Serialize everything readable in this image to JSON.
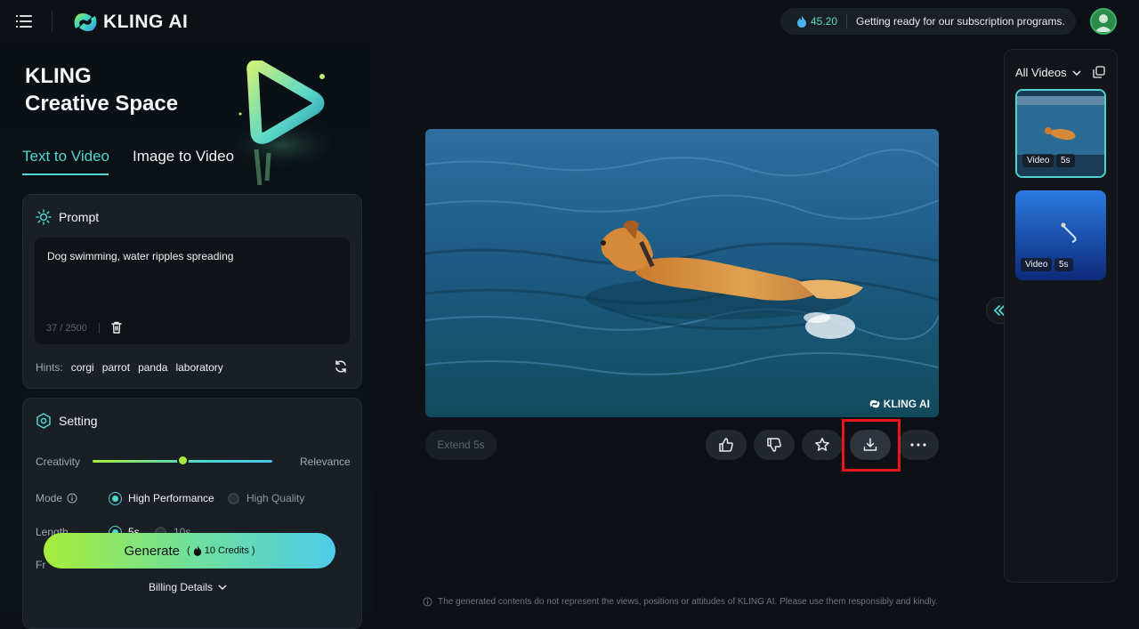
{
  "header": {
    "brand": "KLING AI",
    "credits_amount": "45.20",
    "announcement": "Getting ready for our subscription programs."
  },
  "hero": {
    "line1": "KLING",
    "line2": "Creative Space"
  },
  "tabs": [
    {
      "label": "Text to Video",
      "active": true
    },
    {
      "label": "Image to Video",
      "active": false
    }
  ],
  "prompt": {
    "title": "Prompt",
    "value": "Dog swimming, water ripples spreading",
    "counter": "37 / 2500",
    "hints_label": "Hints:",
    "hints": [
      "corgi",
      "parrot",
      "panda",
      "laboratory"
    ]
  },
  "setting": {
    "title": "Setting",
    "creativity_label": "Creativity",
    "relevance_label": "Relevance",
    "slider_fraction": 0.5,
    "mode_label": "Mode",
    "mode_options": [
      "High Performance",
      "High Quality"
    ],
    "mode_selected": "High Performance",
    "length_label": "Length",
    "length_options": [
      "5s",
      "10s"
    ],
    "length_selected": "5s",
    "frame_label": "Fr"
  },
  "generate": {
    "label": "Generate",
    "credits": "10 Credits",
    "billing": "Billing Details"
  },
  "player": {
    "watermark": "KLING AI",
    "extend_label": "Extend 5s",
    "actions": [
      "like-icon",
      "dislike-icon",
      "star-icon",
      "download-icon",
      "more-icon"
    ]
  },
  "gallery": {
    "filter_label": "All Videos",
    "items": [
      {
        "type": "Video",
        "duration": "5s",
        "selected": true
      },
      {
        "type": "Video",
        "duration": "5s",
        "selected": false
      }
    ]
  },
  "footer": {
    "disclaimer": "The generated contents do not represent the views, positions or attitudes of KLING AI. Please use them responsibly and kindly."
  },
  "colors": {
    "accent": "#4ed7d0",
    "highlight": "#e8151b",
    "lime": "#a6ec3a"
  }
}
